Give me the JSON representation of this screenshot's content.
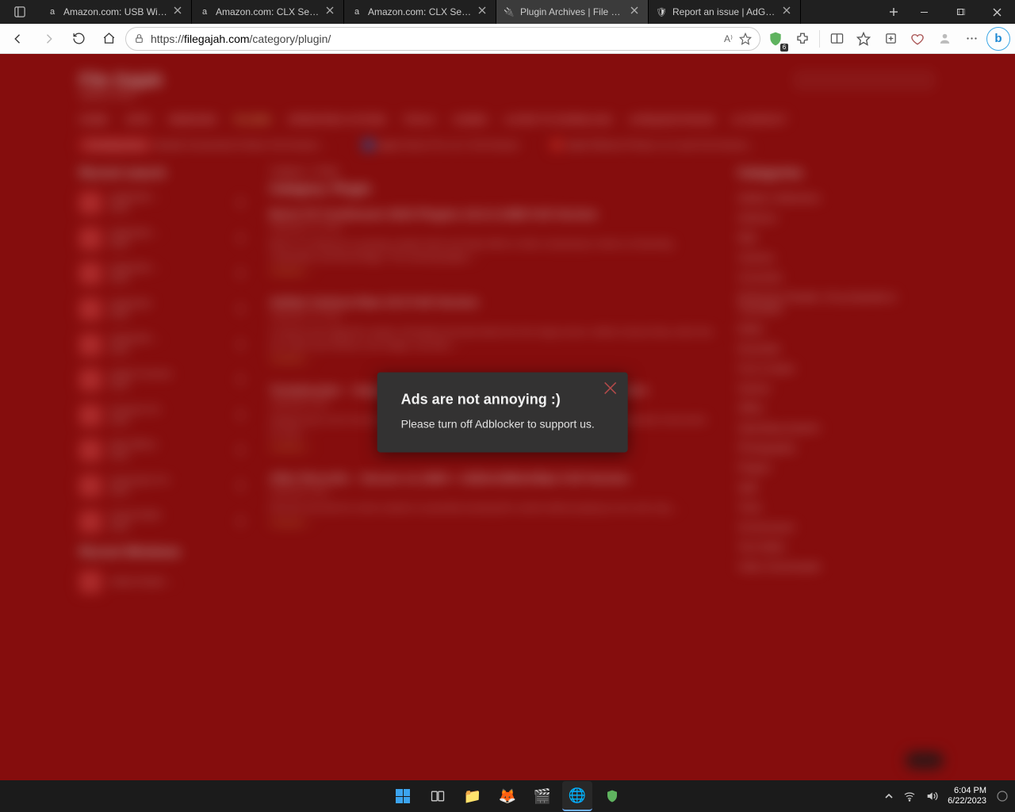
{
  "tabs": [
    {
      "label": "Amazon.com: USB WiFi Ad",
      "favicon": "a"
    },
    {
      "label": "Amazon.com: CLX Set Gam",
      "favicon": "a"
    },
    {
      "label": "Amazon.com: CLX Set Gam",
      "favicon": "a"
    },
    {
      "label": "Plugin Archives | File Gaja",
      "favicon": "🔌",
      "active": true
    },
    {
      "label": "Report an issue | AdGuard",
      "favicon": "🛡"
    }
  ],
  "address": {
    "scheme": "https://",
    "host": "filegajah.com",
    "path": "/category/plugin/"
  },
  "adguard_badge": "6",
  "modal": {
    "title": "Ads are not annoying :)",
    "body": "Please turn off Adblocker to support us."
  },
  "page": {
    "site_title": "File Gajah",
    "site_sub": "Aplikasi Gratis",
    "nav": [
      "HOME",
      "APPS",
      "WINDOWS",
      "PLUGIN",
      "OPERATING SYSTEM",
      "TOOLS",
      "GAMES",
      "HOW TO DOWNLOAD",
      "REQUEST/ISSUE",
      "CONTACT"
    ],
    "nav_highlight_index": 3,
    "recent_title": "Recent search",
    "recent_items": [
      "September …",
      "September …",
      "September …",
      "September",
      "September …",
      "Adobe Premiere",
      "Premiere Pro",
      "After Effects",
      "Vectoraster Pro",
      "Sequel Editor"
    ],
    "recent_win_title": "Recent Windows",
    "breadcrumb": "Category > Plugin",
    "main_heading": "Category: Plugin",
    "posts": [
      {
        "title": "Boris FX Continuum 2023 Plugins 16.0.3.1086 Full Version",
        "body": "Boris FX Continuum is pushing creative limits and helps effect & video composing to make an interesting composition and final footage. This amazing plugins …",
        "meta": "September 20, 2023"
      },
      {
        "title": "Adobe Camera Raw 15.5 Full Version",
        "body": "A camera raw image file contains minimally processed data from the image sensor. Adobe Camera Raw, which lets you import and enhance raw images, has been …",
        "meta": "September 19, 2023"
      },
      {
        "title": "Tonebooster – Separate Processing Audio plugin 1.6.4 Full Version",
        "body": "Already have a lot of music reverbed or composed? Worry not, this AI powered processing separates instruments of music …",
        "meta": "September 2023"
      },
      {
        "title": "After Records – Secure v1.1900 + 1920x1080x24fps Full Version",
        "body": "Records and tools for movie creators to assemble amazing film content without paying an arm and a leg …",
        "meta": "September 2023"
      }
    ],
    "categories_title": "Categories",
    "categories": [
      "Adobe Collections",
      "Antivirus",
      "Mail",
      "Camera",
      "Converter",
      "Dictionary Reader, Encyclopedia & Translator",
      "Editor",
      "Essential",
      "Font Creator",
      "Games",
      "Office",
      "Operating System",
      "Photography",
      "Plugins",
      "Split",
      "Tools",
      "Screensaver",
      "Text Editor",
      "Video Downloader"
    ]
  },
  "taskbar": {
    "time": "6:04 PM",
    "date": "6/22/2023"
  }
}
